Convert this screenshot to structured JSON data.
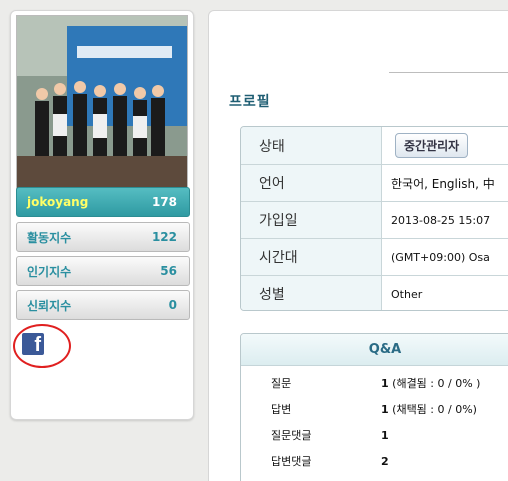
{
  "user": {
    "name": "jokoyang",
    "score": "178"
  },
  "stats": [
    {
      "label": "활동지수",
      "value": "122"
    },
    {
      "label": "인기지수",
      "value": "56"
    },
    {
      "label": "신뢰지수",
      "value": "0"
    }
  ],
  "social": {
    "facebook_glyph": "f"
  },
  "section_title": "프로필",
  "profile": {
    "status_label": "상태",
    "status_value": "중간관리자",
    "language_label": "언어",
    "language_value": "한국어, English, 中",
    "joined_label": "가입일",
    "joined_value": "2013-08-25 15:07",
    "timezone_label": "시간대",
    "timezone_value": "(GMT+09:00) Osa",
    "gender_label": "성별",
    "gender_value": "Other"
  },
  "qa": {
    "title": "Q&A",
    "rows": [
      {
        "label": "질문",
        "count": "1",
        "detail": " (해결됨 : 0 / 0% )"
      },
      {
        "label": "답변",
        "count": "1",
        "detail": " (채택됨 : 0 / 0%)"
      },
      {
        "label": "질문댓글",
        "count": "1",
        "detail": ""
      },
      {
        "label": "답변댓글",
        "count": "2",
        "detail": ""
      }
    ]
  },
  "colors": {
    "accent": "#2f9aa2",
    "link": "#2a8fa0",
    "facebook": "#3b5998",
    "highlight_circle": "#e02020"
  }
}
